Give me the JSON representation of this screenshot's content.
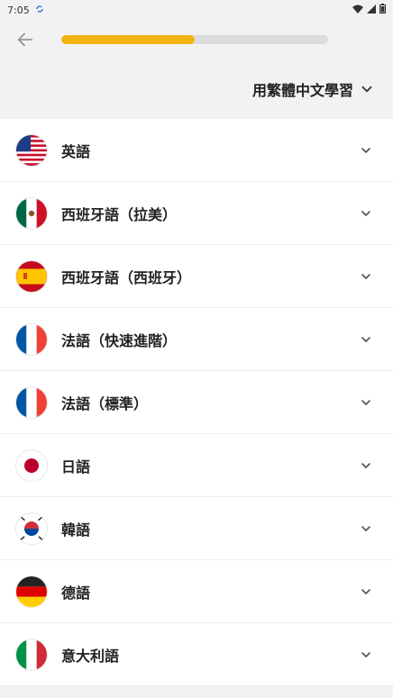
{
  "status": {
    "time": "7:05",
    "icons": [
      "sync-icon",
      "wifi-icon",
      "signal-icon",
      "battery-icon"
    ]
  },
  "header": {
    "back_icon": "arrow-left-icon",
    "progress": 0.5,
    "progress_color": "#f5b311"
  },
  "language_selector": {
    "label": "用繁體中文學習",
    "icon": "chevron-down-icon"
  },
  "courses": [
    {
      "label": "英語",
      "flag": "us-flag-icon"
    },
    {
      "label": "西班牙語（拉美）",
      "flag": "mexico-flag-icon"
    },
    {
      "label": "西班牙語（西班牙）",
      "flag": "spain-flag-icon"
    },
    {
      "label": "法語（快速進階）",
      "flag": "france-flag-icon"
    },
    {
      "label": "法語（標準）",
      "flag": "france-flag-icon"
    },
    {
      "label": "日語",
      "flag": "japan-flag-icon"
    },
    {
      "label": "韓語",
      "flag": "korea-flag-icon"
    },
    {
      "label": "德語",
      "flag": "germany-flag-icon"
    },
    {
      "label": "意大利語",
      "flag": "italy-flag-icon"
    }
  ]
}
